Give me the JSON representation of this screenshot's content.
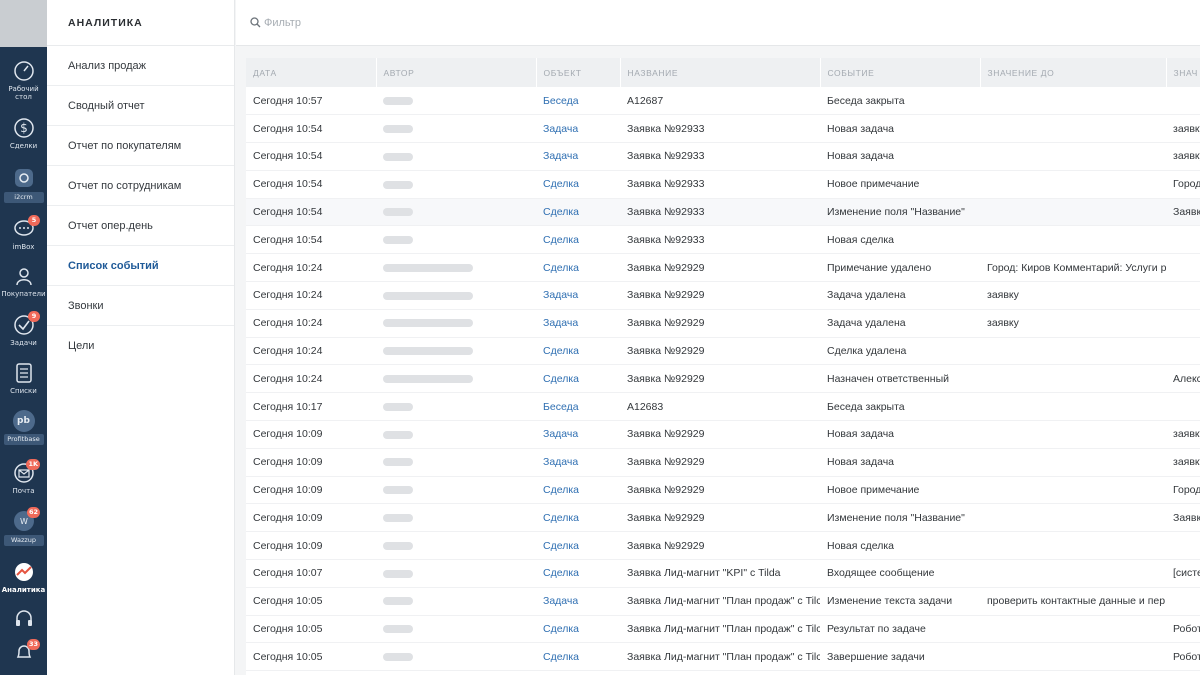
{
  "rail": {
    "items": [
      {
        "label": "Рабочий\nстол",
        "icon": "dashboard-icon"
      },
      {
        "label": "Сделки",
        "icon": "dollar-icon"
      },
      {
        "label": "i2crm",
        "icon": "i2crm-icon"
      },
      {
        "label": "imBox",
        "icon": "chat-icon",
        "badge": "5"
      },
      {
        "label": "Покупатели",
        "icon": "user-icon"
      },
      {
        "label": "Задачи",
        "icon": "check-icon",
        "badge": "9"
      },
      {
        "label": "Списки",
        "icon": "list-icon"
      },
      {
        "label": "Profitbase",
        "icon": "profitbase-icon",
        "circle": "pb"
      },
      {
        "label": "Почта",
        "icon": "mail-icon",
        "badge": "1K"
      },
      {
        "label": "Wazzup",
        "icon": "wazzup-icon",
        "badge": "62"
      },
      {
        "label": "Аналитика",
        "icon": "analytics-icon"
      }
    ],
    "bottom_badge": "33"
  },
  "nav": {
    "title": "АНАЛИТИКА",
    "items": [
      "Анализ продаж",
      "Сводный отчет",
      "Отчет по покупателям",
      "Отчет по сотрудникам",
      "Отчет опер.день",
      "Список событий",
      "Звонки",
      "Цели"
    ],
    "active_index": 5
  },
  "filter": {
    "placeholder": "Фильтр"
  },
  "table": {
    "headers": [
      "ДАТА",
      "АВТОР",
      "ОБЪЕКТ",
      "НАЗВАНИЕ",
      "СОБЫТИЕ",
      "ЗНАЧЕНИЕ ДО",
      "ЗНАЧ"
    ],
    "rows": [
      {
        "date": "Сегодня 10:57",
        "author": "short",
        "object": "Беседа",
        "name": "A12687",
        "event": "Беседа закрыта",
        "before": "",
        "after": ""
      },
      {
        "date": "Сегодня 10:54",
        "author": "short",
        "object": "Задача",
        "name": "Заявка №92933",
        "event": "Новая задача",
        "before": "",
        "after": "заявку"
      },
      {
        "date": "Сегодня 10:54",
        "author": "short",
        "object": "Задача",
        "name": "Заявка №92933",
        "event": "Новая задача",
        "before": "",
        "after": "заявку"
      },
      {
        "date": "Сегодня 10:54",
        "author": "short",
        "object": "Сделка",
        "name": "Заявка №92933",
        "event": "Новое примечание",
        "before": "",
        "after": "Город"
      },
      {
        "date": "Сегодня 10:54",
        "author": "short",
        "object": "Сделка",
        "name": "Заявка №92933",
        "event": "Изменение поля \"Название\"",
        "before": "",
        "after": "Заявк"
      },
      {
        "date": "Сегодня 10:54",
        "author": "short",
        "object": "Сделка",
        "name": "Заявка №92933",
        "event": "Новая сделка",
        "before": "",
        "after": ""
      },
      {
        "date": "Сегодня 10:24",
        "author": "long",
        "object": "Сделка",
        "name": "Заявка №92929",
        "event": "Примечание удалено",
        "before": "Город: Киров Комментарий: Услуги р",
        "after": ""
      },
      {
        "date": "Сегодня 10:24",
        "author": "long",
        "object": "Задача",
        "name": "Заявка №92929",
        "event": "Задача удалена",
        "before": "заявку",
        "after": ""
      },
      {
        "date": "Сегодня 10:24",
        "author": "long",
        "object": "Задача",
        "name": "Заявка №92929",
        "event": "Задача удалена",
        "before": "заявку",
        "after": ""
      },
      {
        "date": "Сегодня 10:24",
        "author": "long",
        "object": "Сделка",
        "name": "Заявка №92929",
        "event": "Сделка удалена",
        "before": "",
        "after": ""
      },
      {
        "date": "Сегодня 10:24",
        "author": "long",
        "object": "Сделка",
        "name": "Заявка №92929",
        "event": "Назначен ответственный",
        "before": "",
        "after": "Алекс"
      },
      {
        "date": "Сегодня 10:17",
        "author": "short",
        "object": "Беседа",
        "name": "A12683",
        "event": "Беседа закрыта",
        "before": "",
        "after": ""
      },
      {
        "date": "Сегодня 10:09",
        "author": "short",
        "object": "Задача",
        "name": "Заявка №92929",
        "event": "Новая задача",
        "before": "",
        "after": "заявку"
      },
      {
        "date": "Сегодня 10:09",
        "author": "short",
        "object": "Задача",
        "name": "Заявка №92929",
        "event": "Новая задача",
        "before": "",
        "after": "заявку"
      },
      {
        "date": "Сегодня 10:09",
        "author": "short",
        "object": "Сделка",
        "name": "Заявка №92929",
        "event": "Новое примечание",
        "before": "",
        "after": "Город"
      },
      {
        "date": "Сегодня 10:09",
        "author": "short",
        "object": "Сделка",
        "name": "Заявка №92929",
        "event": "Изменение поля \"Название\"",
        "before": "",
        "after": "Заявк"
      },
      {
        "date": "Сегодня 10:09",
        "author": "short",
        "object": "Сделка",
        "name": "Заявка №92929",
        "event": "Новая сделка",
        "before": "",
        "after": ""
      },
      {
        "date": "Сегодня 10:07",
        "author": "short",
        "object": "Сделка",
        "name": "Заявка Лид-магнит \"KPI\" с Tilda",
        "event": "Входящее сообщение",
        "before": "",
        "after": "[систе"
      },
      {
        "date": "Сегодня 10:05",
        "author": "short",
        "object": "Задача",
        "name": "Заявка Лид-магнит \"План продаж\" с Tilc",
        "event": "Изменение текста задачи",
        "before": "проверить контактные данные и пер",
        "after": ""
      },
      {
        "date": "Сегодня 10:05",
        "author": "short",
        "object": "Сделка",
        "name": "Заявка Лид-магнит \"План продаж\" с Tilc",
        "event": "Результат по задаче",
        "before": "",
        "after": "Робот"
      },
      {
        "date": "Сегодня 10:05",
        "author": "short",
        "object": "Сделка",
        "name": "Заявка Лид-магнит \"План продаж\" с Tilc",
        "event": "Завершение задачи",
        "before": "",
        "after": "Робот"
      }
    ],
    "highlight_row": 4
  },
  "colors": {
    "rail_bg": "#1f3650",
    "link": "#2f6fb2",
    "badge": "#f06a5a",
    "active_nav": "#1f5a98"
  }
}
